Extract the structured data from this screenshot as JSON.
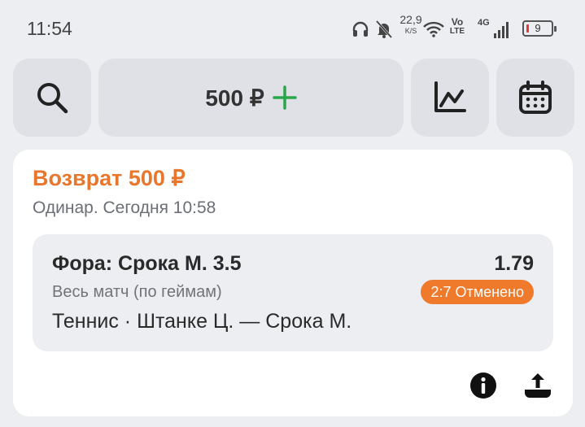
{
  "status_bar": {
    "time": "11:54",
    "speed_value": "22,9",
    "speed_unit": "K/S",
    "volte_top": "Vo",
    "volte_bottom": "LTE",
    "network": "4G",
    "battery_level": "9",
    "icons": [
      "headphones-icon",
      "bell-muted-icon",
      "wifi-icon",
      "signal-icon",
      "battery-icon"
    ]
  },
  "toolbar": {
    "balance": "500 ₽",
    "icons": [
      "search-icon",
      "plus-icon",
      "chart-icon",
      "calendar-icon"
    ],
    "accent_color": "#2aa64a"
  },
  "bet_card": {
    "status": "Возврат 500 ₽",
    "status_color": "#e8762d",
    "subtitle": "Одинар. Сегодня 10:58",
    "selection": {
      "market": "Фора: Срока М. 3.5",
      "odds": "1.79",
      "period": "Весь матч (по геймам)",
      "badge": "2:7 Отменено",
      "badge_color": "#f07a2c",
      "event": "Теннис · Штанке Ц. — Срока М."
    },
    "actions": [
      "info-icon",
      "share-icon"
    ]
  }
}
